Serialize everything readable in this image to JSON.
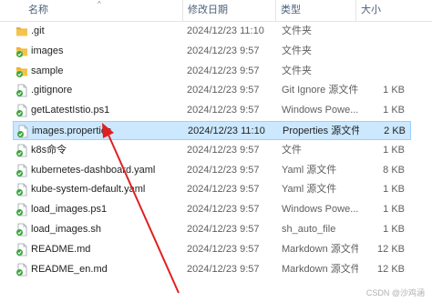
{
  "columns": {
    "name": "名称",
    "date": "修改日期",
    "type": "类型",
    "size": "大小"
  },
  "sort_indicator": "^",
  "files": [
    {
      "name": ".git",
      "date": "2024/12/23 11:10",
      "type": "文件夹",
      "size": "",
      "icon": "folder-icon",
      "selected": false
    },
    {
      "name": "images",
      "date": "2024/12/23 9:57",
      "type": "文件夹",
      "size": "",
      "icon": "synced-folder-icon",
      "selected": false
    },
    {
      "name": "sample",
      "date": "2024/12/23 9:57",
      "type": "文件夹",
      "size": "",
      "icon": "synced-folder-icon",
      "selected": false
    },
    {
      "name": ".gitignore",
      "date": "2024/12/23 9:57",
      "type": "Git Ignore 源文件",
      "size": "1 KB",
      "icon": "synced-file-icon",
      "selected": false
    },
    {
      "name": "getLatestIstio.ps1",
      "date": "2024/12/23 9:57",
      "type": "Windows Powe...",
      "size": "1 KB",
      "icon": "synced-file-icon",
      "selected": false
    },
    {
      "name": "images.properties",
      "date": "2024/12/23 11:10",
      "type": "Properties 源文件",
      "size": "2 KB",
      "icon": "synced-file-icon",
      "selected": true
    },
    {
      "name": "k8s命令",
      "date": "2024/12/23 9:57",
      "type": "文件",
      "size": "1 KB",
      "icon": "synced-file-icon",
      "selected": false
    },
    {
      "name": "kubernetes-dashboard.yaml",
      "date": "2024/12/23 9:57",
      "type": "Yaml 源文件",
      "size": "8 KB",
      "icon": "synced-file-icon",
      "selected": false
    },
    {
      "name": "kube-system-default.yaml",
      "date": "2024/12/23 9:57",
      "type": "Yaml 源文件",
      "size": "1 KB",
      "icon": "synced-file-icon",
      "selected": false
    },
    {
      "name": "load_images.ps1",
      "date": "2024/12/23 9:57",
      "type": "Windows Powe...",
      "size": "1 KB",
      "icon": "synced-file-icon",
      "selected": false
    },
    {
      "name": "load_images.sh",
      "date": "2024/12/23 9:57",
      "type": "sh_auto_file",
      "size": "1 KB",
      "icon": "synced-file-icon",
      "selected": false
    },
    {
      "name": "README.md",
      "date": "2024/12/23 9:57",
      "type": "Markdown 源文件",
      "size": "12 KB",
      "icon": "synced-file-icon",
      "selected": false
    },
    {
      "name": "README_en.md",
      "date": "2024/12/23 9:57",
      "type": "Markdown 源文件",
      "size": "12 KB",
      "icon": "synced-file-icon",
      "selected": false
    }
  ],
  "watermark": "CSDN @沙鸡涵",
  "colors": {
    "selection_bg": "#cce8ff",
    "selection_border": "#99d1ff",
    "folder": "#f4c44e",
    "sync_badge": "#3aa63a",
    "arrow": "#e02020"
  }
}
